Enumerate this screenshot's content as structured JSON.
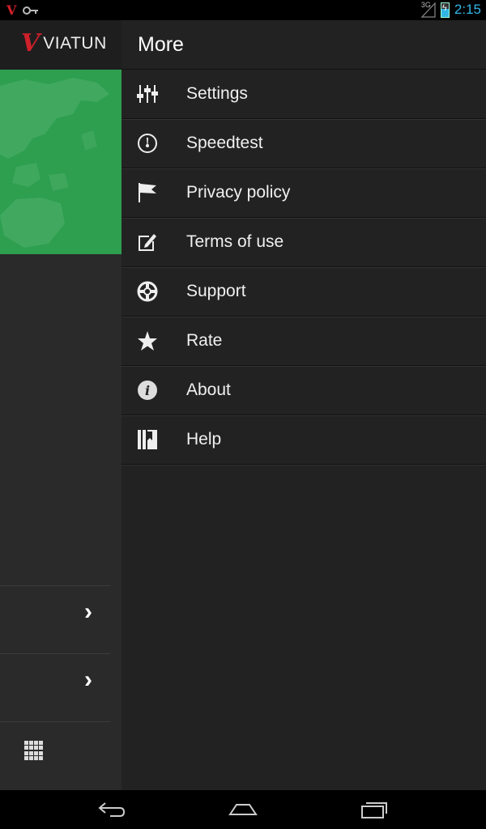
{
  "status_bar": {
    "time": "2:15",
    "network": "3G"
  },
  "app": {
    "logo_text": "VIATUN",
    "logo_letter": "V"
  },
  "drawer": {
    "title": "More",
    "items": [
      {
        "label": "Settings",
        "icon": "settings-sliders-icon"
      },
      {
        "label": "Speedtest",
        "icon": "speedometer-icon"
      },
      {
        "label": "Privacy policy",
        "icon": "flag-icon"
      },
      {
        "label": "Terms of use",
        "icon": "edit-icon"
      },
      {
        "label": "Support",
        "icon": "lifebuoy-icon"
      },
      {
        "label": "Rate",
        "icon": "star-icon"
      },
      {
        "label": "About",
        "icon": "info-icon"
      },
      {
        "label": "Help",
        "icon": "book-icon"
      }
    ]
  },
  "colors": {
    "accent": "#33b5e5",
    "map_green": "#2e9e4f",
    "brand_red": "#d0202a",
    "drawer_bg": "#222222"
  }
}
